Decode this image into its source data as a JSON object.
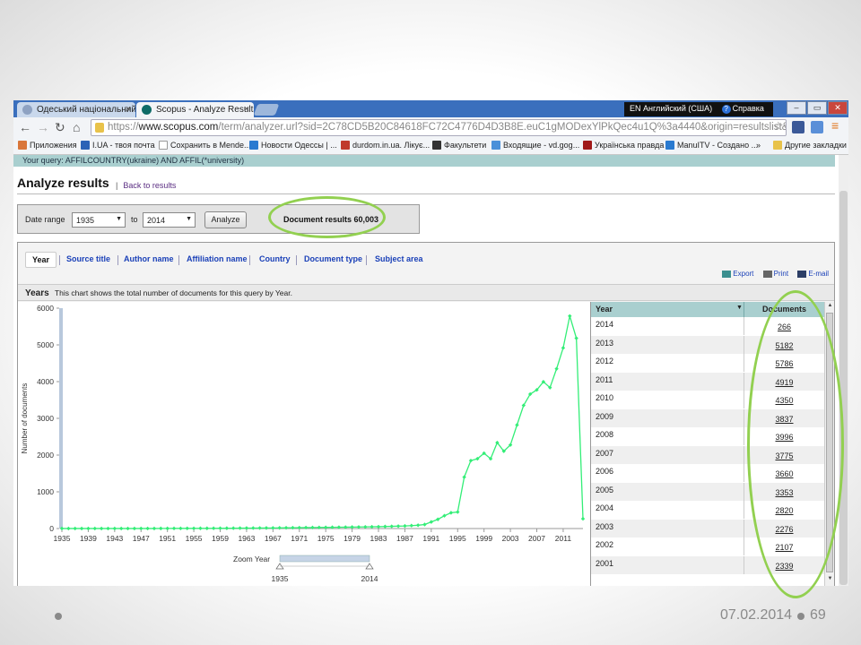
{
  "browser": {
    "tabs": [
      {
        "label": "Одеський національний",
        "close": "×"
      },
      {
        "label": "Scopus - Analyze Results",
        "close": "×"
      }
    ],
    "language_indicator": "EN Английский (США)",
    "help_label": "Справка",
    "url": {
      "scheme": "https://",
      "domain": "www.scopus.com",
      "path": "/term/analyzer.url?sid=2C78CD5B20C84618FC72C4776D4D3B8E.euC1gMODexYlPkQec4u1Q%3a4440&origin=resultslist&src=s&s"
    },
    "bookmarks": [
      "Приложения",
      "I.UA - твоя почта",
      "Сохранить в Mende...",
      "Новости Одессы | ...",
      "durdom.in.ua. Лікує...",
      "Факультети",
      "Входящие - vd.gog...",
      "Українська правда",
      "ManuITV - Создано ...",
      "»",
      "Другие закладки"
    ]
  },
  "page": {
    "query_prefix": "Your query:",
    "query_text": "AFFILCOUNTRY(ukraine) AND AFFIL(*university)",
    "title": "Analyze results",
    "back_link": "Back to results",
    "date_range_label": "Date range",
    "from_year": "1935",
    "to_label": "to",
    "to_year": "2014",
    "analyze_button": "Analyze",
    "document_results": "Document results 60,003",
    "tabs": [
      "Year",
      "Source title",
      "Author name",
      "Affiliation name",
      "Country",
      "Document type",
      "Subject area"
    ],
    "actions": [
      "Export",
      "Print",
      "E-mail"
    ],
    "years_heading": "Years",
    "years_description": "This chart shows the total number of documents for this query by Year.",
    "zoom_label": "Zoom Year",
    "zoom_from": "1935",
    "zoom_to": "2014",
    "table_headers": {
      "year": "Year",
      "documents": "Documents"
    },
    "table_rows": [
      {
        "year": "2014",
        "docs": "266"
      },
      {
        "year": "2013",
        "docs": "5182"
      },
      {
        "year": "2012",
        "docs": "5786"
      },
      {
        "year": "2011",
        "docs": "4919"
      },
      {
        "year": "2010",
        "docs": "4350"
      },
      {
        "year": "2009",
        "docs": "3837"
      },
      {
        "year": "2008",
        "docs": "3996"
      },
      {
        "year": "2007",
        "docs": "3775"
      },
      {
        "year": "2006",
        "docs": "3660"
      },
      {
        "year": "2005",
        "docs": "3353"
      },
      {
        "year": "2004",
        "docs": "2820"
      },
      {
        "year": "2003",
        "docs": "2276"
      },
      {
        "year": "2002",
        "docs": "2107"
      },
      {
        "year": "2001",
        "docs": "2339"
      }
    ]
  },
  "slide": {
    "date": "07.02.2014",
    "page_number": "69"
  },
  "colors": {
    "line": "#33ee77",
    "highlight": "#92d050",
    "table_header": "#a9cfcf",
    "link": "#1b41b8"
  },
  "chart_data": {
    "type": "line",
    "title": "",
    "xlabel": "",
    "ylabel": "Number of documents",
    "ylim": [
      0,
      6000
    ],
    "xlim": [
      1935,
      2014
    ],
    "yticks": [
      0,
      1000,
      2000,
      3000,
      4000,
      5000,
      6000
    ],
    "xticks": [
      1935,
      1939,
      1943,
      1947,
      1951,
      1955,
      1959,
      1963,
      1967,
      1971,
      1975,
      1979,
      1983,
      1987,
      1991,
      1995,
      1999,
      2003,
      2007,
      2011
    ],
    "x": [
      1935,
      1936,
      1937,
      1938,
      1939,
      1940,
      1941,
      1942,
      1943,
      1944,
      1945,
      1946,
      1947,
      1948,
      1949,
      1950,
      1951,
      1952,
      1953,
      1954,
      1955,
      1956,
      1957,
      1958,
      1959,
      1960,
      1961,
      1962,
      1963,
      1964,
      1965,
      1966,
      1967,
      1968,
      1969,
      1970,
      1971,
      1972,
      1973,
      1974,
      1975,
      1976,
      1977,
      1978,
      1979,
      1980,
      1981,
      1982,
      1983,
      1984,
      1985,
      1986,
      1987,
      1988,
      1989,
      1990,
      1991,
      1992,
      1993,
      1994,
      1995,
      1996,
      1997,
      1998,
      1999,
      2000,
      2001,
      2002,
      2003,
      2004,
      2005,
      2006,
      2007,
      2008,
      2009,
      2010,
      2011,
      2012,
      2013,
      2014
    ],
    "y": [
      1,
      1,
      1,
      1,
      1,
      1,
      1,
      1,
      1,
      1,
      1,
      1,
      2,
      2,
      2,
      3,
      3,
      4,
      4,
      5,
      5,
      6,
      6,
      7,
      8,
      9,
      10,
      11,
      12,
      13,
      14,
      15,
      16,
      18,
      20,
      22,
      24,
      26,
      28,
      30,
      32,
      34,
      36,
      38,
      40,
      42,
      45,
      48,
      50,
      55,
      60,
      65,
      70,
      80,
      90,
      110,
      180,
      250,
      350,
      430,
      450,
      1400,
      1850,
      1900,
      2050,
      1900,
      2339,
      2107,
      2276,
      2820,
      3353,
      3660,
      3775,
      3996,
      3837,
      4350,
      4919,
      5786,
      5182,
      266
    ]
  }
}
